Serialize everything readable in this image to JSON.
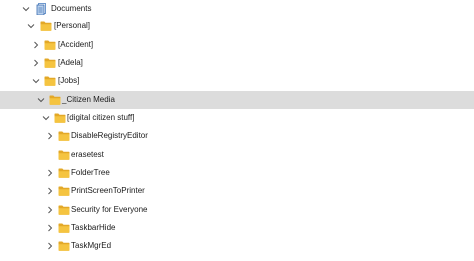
{
  "tree": {
    "root": {
      "label": "Documents",
      "icon": "documents-library-icon",
      "state": "expanded"
    },
    "items": [
      {
        "label": "[Personal]",
        "icon": "folder-icon",
        "state": "expanded"
      },
      {
        "label": "[Accident]",
        "icon": "folder-icon",
        "state": "collapsed"
      },
      {
        "label": "[Adela]",
        "icon": "folder-icon",
        "state": "collapsed"
      },
      {
        "label": "[Jobs]",
        "icon": "folder-icon",
        "state": "expanded"
      },
      {
        "label": "_Citizen Media",
        "icon": "folder-icon",
        "state": "expanded",
        "selected": true
      },
      {
        "label": "[digital citizen stuff]",
        "icon": "folder-icon",
        "state": "expanded"
      },
      {
        "label": "DisableRegistryEditor",
        "icon": "folder-icon",
        "state": "collapsed"
      },
      {
        "label": "erasetest",
        "icon": "folder-icon",
        "state": "leaf"
      },
      {
        "label": "FolderTree",
        "icon": "folder-icon",
        "state": "collapsed"
      },
      {
        "label": "PrintScreenToPrinter",
        "icon": "folder-icon",
        "state": "collapsed"
      },
      {
        "label": "Security for Everyone",
        "icon": "folder-icon",
        "state": "collapsed"
      },
      {
        "label": "TaskbarHide",
        "icon": "folder-icon",
        "state": "collapsed"
      },
      {
        "label": "TaskMgrEd",
        "icon": "folder-icon",
        "state": "collapsed"
      }
    ]
  },
  "colors": {
    "selection": "#dcdcdc",
    "folder": "#f5c440",
    "folder_back": "#e3a827",
    "chevron": "#555555",
    "text": "#1b1b1b"
  }
}
